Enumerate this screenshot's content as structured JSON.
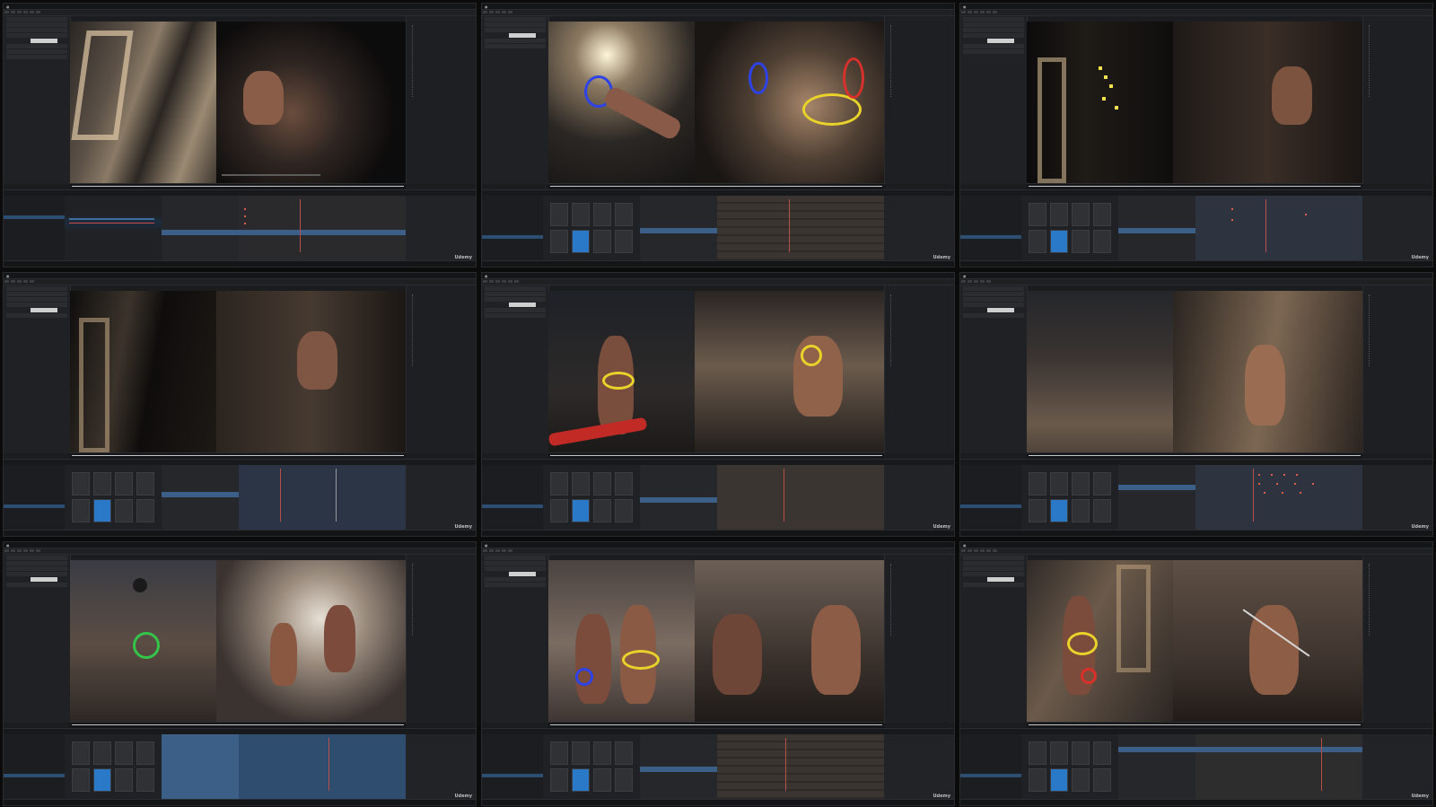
{
  "watermark": "Udemy",
  "cells": [
    {
      "id": "p1",
      "left_view": "gantry-wide",
      "right_view": "portrait-closeup"
    },
    {
      "id": "p2",
      "left_view": "rig-arena",
      "right_view": "rig-closeup"
    },
    {
      "id": "p3",
      "left_view": "gantry-lights",
      "right_view": "portrait-profile"
    },
    {
      "id": "p4",
      "left_view": "gantry-shadow",
      "right_view": "portrait-shadow"
    },
    {
      "id": "p5",
      "left_view": "rig-helmet",
      "right_view": "back-shield"
    },
    {
      "id": "p6",
      "left_view": "arena-corridor",
      "right_view": "back-spear"
    },
    {
      "id": "p7",
      "left_view": "arena-crane",
      "right_view": "smoke-fight"
    },
    {
      "id": "p8",
      "left_view": "rig-fight",
      "right_view": "duel-closeup"
    },
    {
      "id": "p9",
      "left_view": "rig-pose",
      "right_view": "sword-pose"
    }
  ],
  "colors": {
    "bg": "#0b0b0c",
    "panel": "#1b1c1e",
    "accent_blue": "#2a78c8",
    "rig_yellow": "#e9d32b",
    "rig_blue": "#2d43e8",
    "rig_red": "#d8312b",
    "key_red": "#e05b4f"
  }
}
